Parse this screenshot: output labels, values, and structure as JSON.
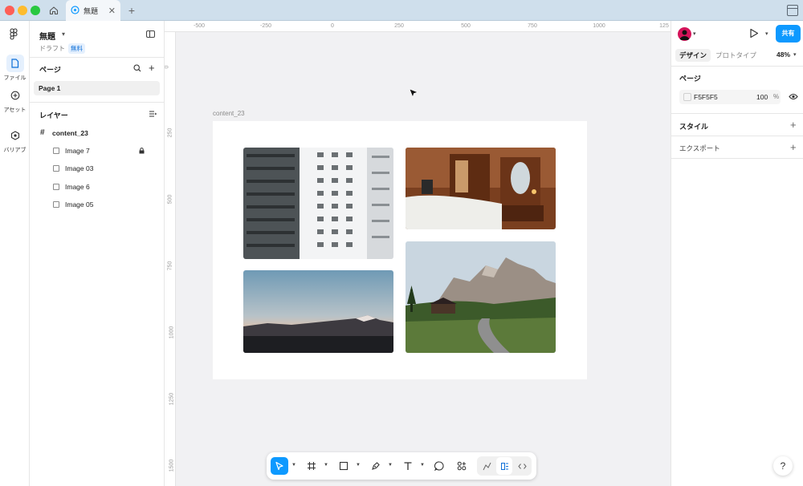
{
  "titlebar": {
    "tab_title": "無題",
    "tab_close": "✕",
    "tab_add": "+"
  },
  "rail": {
    "items": [
      {
        "label": "ファイル",
        "icon": "file-icon"
      },
      {
        "label": "アセット",
        "icon": "assets-icon"
      },
      {
        "label": "バリアブ",
        "icon": "variables-icon"
      }
    ]
  },
  "layers_panel": {
    "file_name": "無題",
    "draft_label": "ドラフト",
    "plan_badge": "無料",
    "pages_title": "ページ",
    "pages": [
      "Page 1"
    ],
    "layers_title": "レイヤー",
    "frame_name": "content_23",
    "layers": [
      {
        "name": "Image 7",
        "locked": true
      },
      {
        "name": "Image 03",
        "locked": false
      },
      {
        "name": "Image 6",
        "locked": false
      },
      {
        "name": "Image 05",
        "locked": false
      }
    ]
  },
  "canvas": {
    "ruler_top": [
      "-500",
      "-250",
      "0",
      "250",
      "500",
      "750",
      "1000",
      "125"
    ],
    "ruler_left": [
      "0",
      "250",
      "500",
      "750",
      "1000",
      "1250",
      "1500"
    ],
    "frame_label": "content_23",
    "background": "#F1F1F3",
    "frame_fill": "#FFFFFF",
    "images": [
      {
        "name": "Image 7",
        "subject": "white apartment building balconies"
      },
      {
        "name": "Image 03",
        "subject": "wooden bedroom interior with vanity"
      },
      {
        "name": "Image 6",
        "subject": "snowy mountain range at dusk"
      },
      {
        "name": "Image 05",
        "subject": "alpine mountains with road and chalet"
      }
    ]
  },
  "toolbar": {
    "tools": [
      "move-tool",
      "frame-tool",
      "rectangle-tool",
      "pen-tool",
      "text-tool",
      "comment-tool",
      "actions-tool"
    ],
    "modes": [
      "draw-mode",
      "design-mode",
      "dev-mode"
    ],
    "active_tool": "move-tool",
    "accent": "#0D99FF"
  },
  "properties_panel": {
    "share_label": "共有",
    "tabs": [
      "デザイン",
      "プロトタイプ"
    ],
    "zoom": "48%",
    "page_section_title": "ページ",
    "page_color_hex": "F5F5F5",
    "page_opacity": "100",
    "opacity_unit": "%",
    "style_title": "スタイル",
    "export_title": "エクスポート",
    "help_label": "?"
  }
}
